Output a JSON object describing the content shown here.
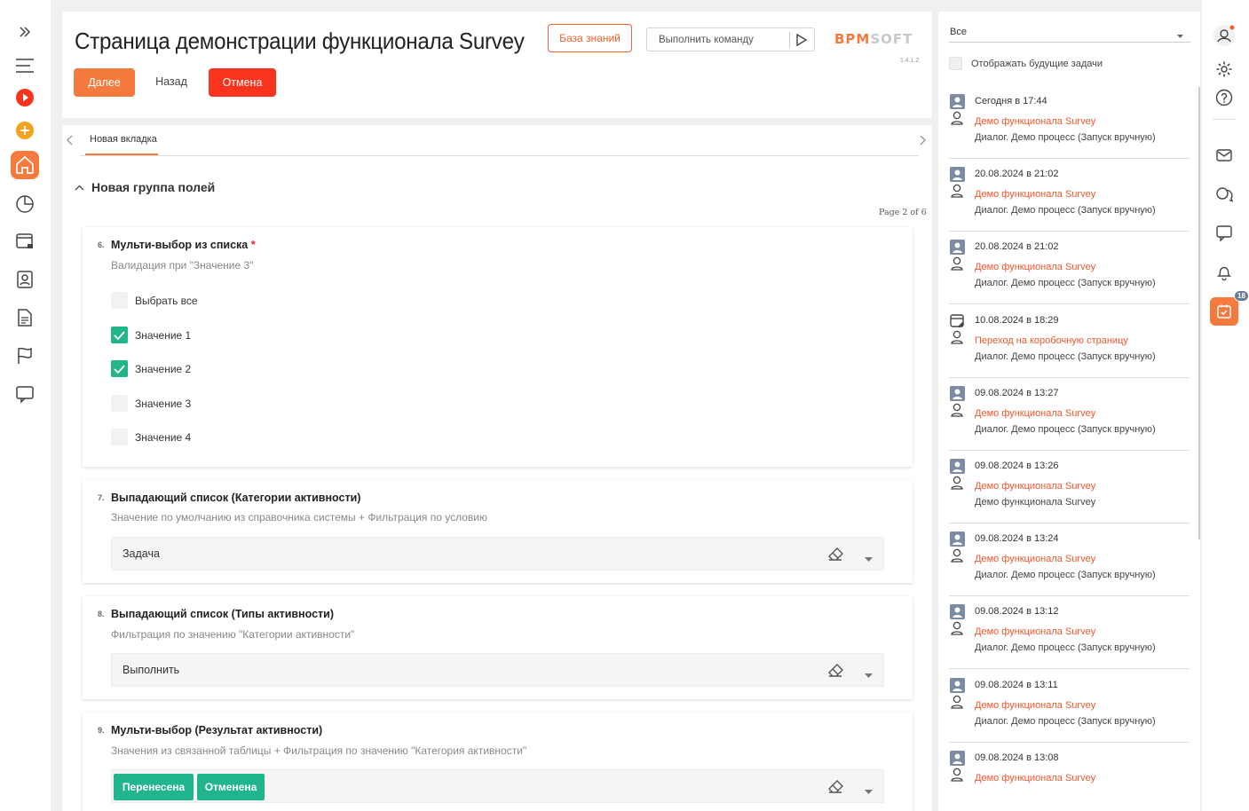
{
  "page": {
    "title": "Страница демонстрации функционала Survey",
    "kb_label": "База знаний",
    "cmd_placeholder": "Выполнить команду",
    "logo_main": "BPM",
    "logo_soft": "SOFT",
    "version": "1.4.1.2",
    "next_label": "Далее",
    "back_label": "Назад",
    "cancel_label": "Отмена"
  },
  "tabs": {
    "active": "Новая вкладка"
  },
  "group": {
    "title": "Новая группа полей",
    "page_info": "Page 2 of 6"
  },
  "q6": {
    "num": "6.",
    "title": "Мульти-выбор из списка",
    "required_mark": "*",
    "subtitle": "Валидация при \"Значение 3\"",
    "options": [
      {
        "label": "Выбрать все",
        "checked": false
      },
      {
        "label": "Значение 1",
        "checked": true
      },
      {
        "label": "Значение 2",
        "checked": true
      },
      {
        "label": "Значение 3",
        "checked": false
      },
      {
        "label": "Значение 4",
        "checked": false
      }
    ]
  },
  "q7": {
    "num": "7.",
    "title": "Выпадающий список (Категории активности)",
    "subtitle": "Значение по умолчанию из справочника системы + Фильтрация по условию",
    "value": "Задача"
  },
  "q8": {
    "num": "8.",
    "title": "Выпадающий список (Типы активности)",
    "subtitle": "Фильтрация по значению \"Категории активности\"",
    "value": "Выполнить"
  },
  "q9": {
    "num": "9.",
    "title": "Мульти-выбор (Результат активности)",
    "subtitle": "Значения из связанной таблицы + Фильтрация по значению \"Категория активности\"",
    "chips": [
      "Перенесена",
      "Отменена"
    ]
  },
  "right_panel": {
    "filter_value": "Все",
    "future_label": "Отображать будущие задачи",
    "tasks": [
      {
        "date": "Сегодня в 17:44",
        "link": "Демо функционала Survey",
        "process": "Диалог. Демо процесс (Запуск вручную)",
        "icon": "user-task-icon"
      },
      {
        "date": "20.08.2024 в 21:02",
        "link": "Демо функционала Survey",
        "process": "Диалог. Демо процесс (Запуск вручную)",
        "icon": "user-task-icon"
      },
      {
        "date": "20.08.2024 в 21:02",
        "link": "Демо функционала Survey",
        "process": "Диалог. Демо процесс (Запуск вручную)",
        "icon": "user-task-icon"
      },
      {
        "date": "10.08.2024 в 18:29",
        "link": "Переход на коробочную страницу",
        "process": "Диалог. Демо процесс (Запуск вручную)",
        "icon": "calendar-edit-icon"
      },
      {
        "date": "09.08.2024 в 13:27",
        "link": "Демо функционала Survey",
        "process": "Диалог. Демо процесс (Запуск вручную)",
        "icon": "user-task-icon"
      },
      {
        "date": "09.08.2024 в 13:26",
        "link": "Демо функционала Survey",
        "process": "Демо функционала Survey",
        "icon": "user-task-icon"
      },
      {
        "date": "09.08.2024 в 13:24",
        "link": "Демо функционала Survey",
        "process": "Диалог. Демо процесс (Запуск вручную)",
        "icon": "user-task-icon"
      },
      {
        "date": "09.08.2024 в 13:12",
        "link": "Демо функционала Survey",
        "process": "Диалог. Демо процесс (Запуск вручную)",
        "icon": "user-task-icon"
      },
      {
        "date": "09.08.2024 в 13:11",
        "link": "Демо функционала Survey",
        "process": "Диалог. Демо процесс (Запуск вручную)",
        "icon": "user-task-icon"
      },
      {
        "date": "09.08.2024 в 13:08",
        "link": "Демо функционала Survey",
        "process": "",
        "icon": "user-task-icon"
      }
    ]
  },
  "rightbar": {
    "task_badge": "18"
  },
  "colors": {
    "accent": "#f47a3d",
    "danger": "#f9341e",
    "success": "#22b58a",
    "link": "#f2562c"
  }
}
